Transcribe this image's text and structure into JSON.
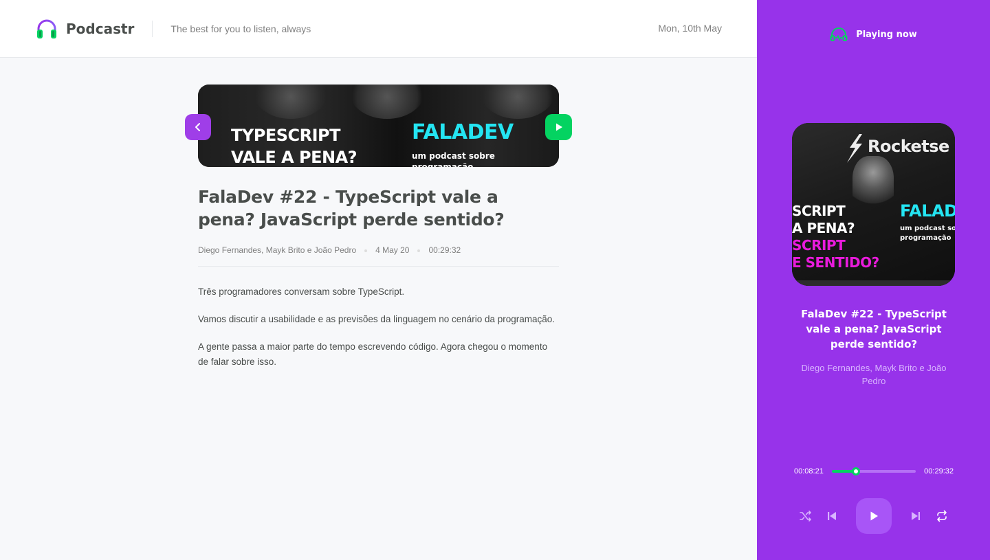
{
  "header": {
    "logo_text": "Podcastr",
    "tagline": "The best for you to listen, always",
    "date": "Mon, 10th May"
  },
  "episode": {
    "thumbnail": {
      "title_line1": "TYPESCRIPT",
      "title_line2": "VALE A PENA?",
      "brand": "FALADEV",
      "subtitle": "um podcast sobre programação"
    },
    "title": "FalaDev #22 - TypeScript vale a pena? JavaScript perde sentido?",
    "members": "Diego Fernandes, Mayk Brito e João Pedro",
    "published_at": "4 May 20",
    "duration": "00:29:32",
    "description": [
      "Três programadores conversam sobre TypeScript.",
      "Vamos discutir a usabilidade e as previsões da linguagem no cenário da programação.",
      "A gente passa a maior parte do tempo escrevendo código. Agora chegou o momento de falar sobre isso."
    ]
  },
  "player": {
    "header_label": "Playing now",
    "cover": {
      "brand_top": "Rocketse",
      "line1": "SCRIPT",
      "line2": "A PENA?",
      "line3": "SCRIPT",
      "line4": "E SENTIDO?",
      "brand": "FALAD",
      "subtitle_line1": "um podcast sob",
      "subtitle_line2": "programação"
    },
    "title": "FalaDev #22 - TypeScript vale a pena? JavaScript perde sentido?",
    "members": "Diego Fernandes, Mayk Brito e João Pedro",
    "current_time": "00:08:21",
    "total_time": "00:29:32",
    "progress_fraction": 0.283
  },
  "icons": {
    "back": "chevron-left-icon",
    "play": "play-icon",
    "playing_now": "headphones-icon",
    "shuffle": "shuffle-icon",
    "previous": "skip-previous-icon",
    "next": "skip-next-icon",
    "repeat": "repeat-icon"
  },
  "colors": {
    "accent": "#9733ea",
    "green": "#04d361",
    "cyan": "#24e5f2",
    "magenta": "#e91bdc",
    "text": "#494d4b",
    "muted": "#808080",
    "background": "#f7f8fa"
  }
}
